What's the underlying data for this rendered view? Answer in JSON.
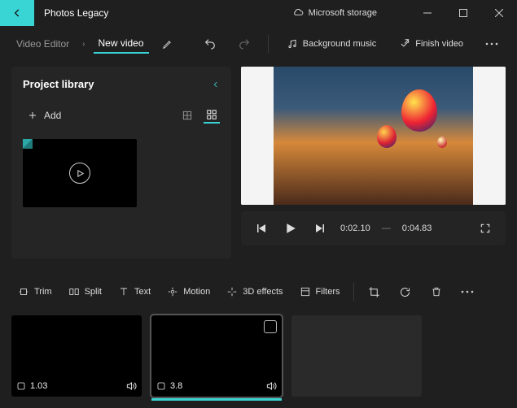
{
  "titlebar": {
    "app_name": "Photos Legacy",
    "cloud_label": "Microsoft storage"
  },
  "tabs": {
    "video_editor": "Video Editor",
    "new_video": "New video"
  },
  "toolbar": {
    "bg_music": "Background music",
    "finish": "Finish video"
  },
  "library": {
    "title": "Project library",
    "add": "Add"
  },
  "player": {
    "current": "0:02.10",
    "total": "0:04.83"
  },
  "tl_tools": {
    "trim": "Trim",
    "split": "Split",
    "text": "Text",
    "motion": "Motion",
    "fx": "3D effects",
    "filters": "Filters"
  },
  "clips": [
    {
      "dur": "1.03"
    },
    {
      "dur": "3.8"
    }
  ]
}
